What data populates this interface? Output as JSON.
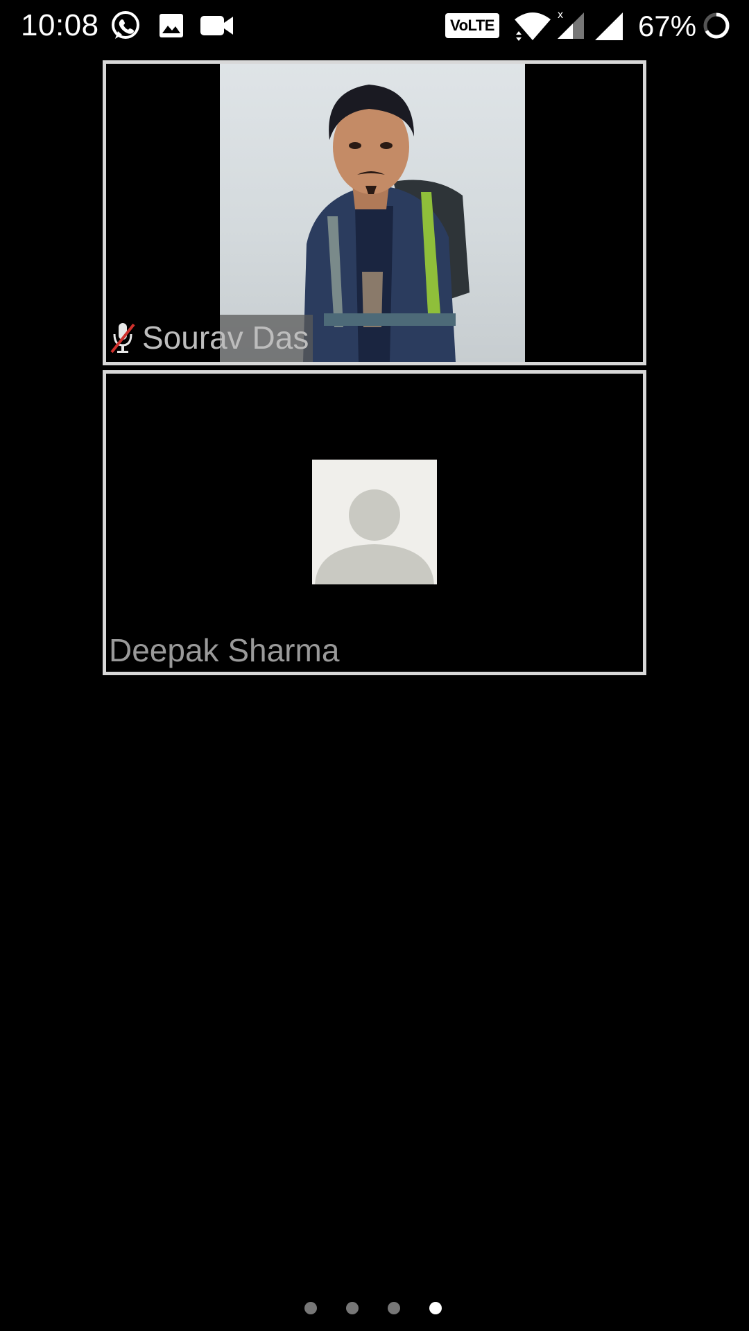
{
  "status_bar": {
    "time": "10:08",
    "notification_icons": [
      "whatsapp-icon",
      "image-icon",
      "video-camera-icon"
    ],
    "volte_label": "VoLTE",
    "battery_percent": "67%",
    "battery_level": 0.67
  },
  "participants": [
    {
      "name": "Sourav Das",
      "muted": true,
      "video_on": true
    },
    {
      "name": "Deepak Sharma",
      "muted": false,
      "video_on": false
    }
  ],
  "pager": {
    "total_pages": 4,
    "active_page": 4
  },
  "colors": {
    "background": "#000000",
    "tile_border": "#d8d8d8",
    "muted_slash": "#d0312d",
    "avatar_bg": "#f0efeb",
    "avatar_silhouette": "#c9c9c2"
  }
}
